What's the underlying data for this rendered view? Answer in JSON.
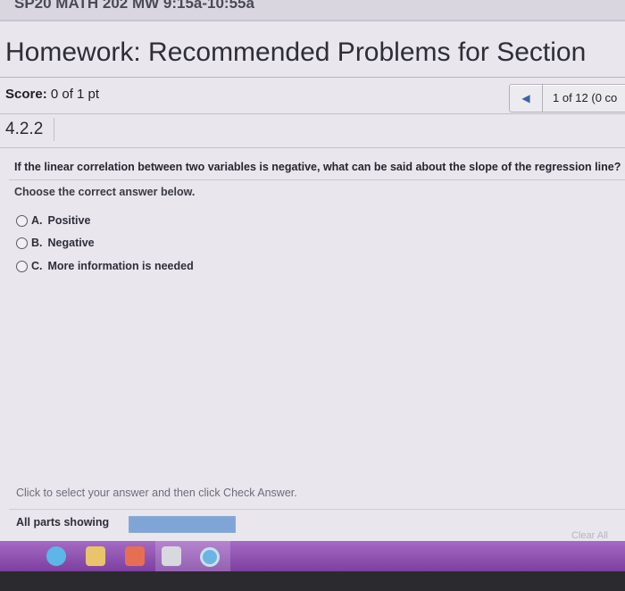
{
  "course": {
    "title": "SP20 MATH 202 MW 9:15a-10:55a"
  },
  "homework": {
    "title": "Homework: Recommended Problems for Section"
  },
  "score": {
    "label": "Score:",
    "value": "0 of 1 pt"
  },
  "navigation": {
    "position": "1 of 12 (0 co"
  },
  "question": {
    "number": "4.2.2",
    "text": "If the linear correlation between two variables is negative, what can be said about the slope of the regression line?",
    "instruction": "Choose the correct answer below.",
    "options": [
      {
        "letter": "A.",
        "text": "Positive"
      },
      {
        "letter": "B.",
        "text": "Negative"
      },
      {
        "letter": "C.",
        "text": "More information is needed"
      }
    ]
  },
  "footer": {
    "hint": "Click to select your answer and then click Check Answer.",
    "parts_label": "All parts showing",
    "clear_all": "Clear All"
  },
  "colors": {
    "accent": "#3a64a8",
    "progress": "#7ea5d6",
    "taskbar": "#8e4fb0"
  },
  "icons": {
    "prev": "triangle-left-icon",
    "taskbar": [
      "ie-icon",
      "file-explorer-icon",
      "store-icon",
      "calculator-icon",
      "chrome-icon"
    ]
  }
}
